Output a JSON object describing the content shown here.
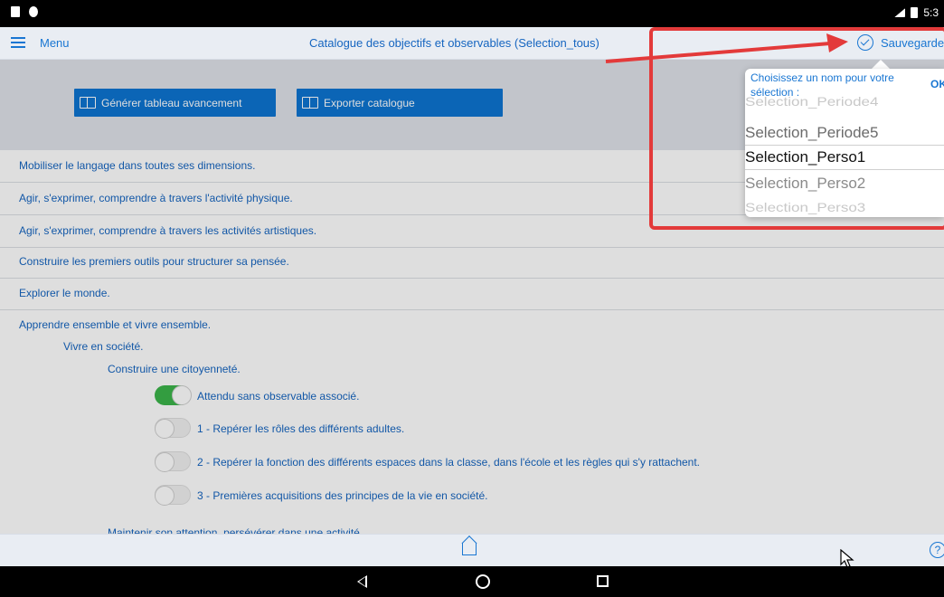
{
  "status_bar": {
    "time": "5:3"
  },
  "header": {
    "menu_label": "Menu",
    "title": "Catalogue des objectifs et observables (Selection_tous)",
    "save_label": "Sauvegarde"
  },
  "toolbar": {
    "btn_progress": "Générer tableau avancement",
    "btn_export": "Exporter catalogue"
  },
  "categories": [
    "Mobiliser le langage dans toutes ses dimensions.",
    "Agir, s'exprimer, comprendre à travers l'activité physique.",
    "Agir, s'exprimer, comprendre à travers les activités artistiques.",
    "Construire les premiers outils pour structurer sa pensée.",
    "Explorer le monde."
  ],
  "expanded": {
    "category": "Apprendre ensemble et vivre ensemble.",
    "subcategory": "Vivre en société.",
    "objective": "Construire une citoyenneté.",
    "items": [
      {
        "label": "Attendu sans observable associé.",
        "on": true
      },
      {
        "label": "1 - Repérer les rôles des différents adultes.",
        "on": false
      },
      {
        "label": "2 - Repérer la fonction des différents espaces dans la classe, dans l'école et les règles qui s'y rattachent.",
        "on": false
      },
      {
        "label": "3 - Premières acquisitions des principes de la vie en société.",
        "on": false
      }
    ],
    "next_objective": "Maintenir son attention, persévérer dans une activité"
  },
  "popover": {
    "title": "Choisissez un nom pour votre sélection :",
    "ok_label": "OK",
    "options": [
      "Selection_Periode4",
      "Selection_Periode5",
      "Selection_Perso1",
      "Selection_Perso2",
      "Selection_Perso3"
    ],
    "selected": "Selection_Perso1"
  },
  "bottom_bar": {
    "help_glyph": "?"
  },
  "accent_color": "#1976d2",
  "highlight_color": "#e33a3a"
}
